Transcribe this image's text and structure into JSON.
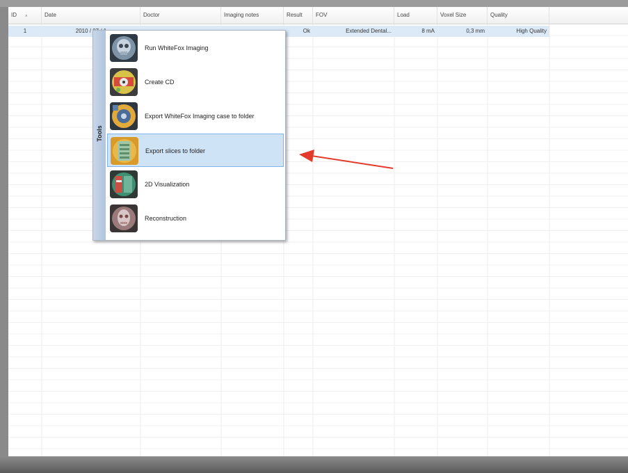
{
  "grid": {
    "columns": [
      "ID",
      "Date",
      "Doctor",
      "Imaging notes",
      "Result",
      "FOV",
      "Load",
      "Voxel Size",
      "Quality"
    ],
    "rows": [
      {
        "id": "1",
        "date": "2010 / 07 / 1",
        "doctor": "",
        "imaging_notes": "",
        "result": "Ok",
        "fov": "Extended Dental...",
        "load": "8 mA",
        "voxel_size": "0,3 mm",
        "quality": "High Quality"
      }
    ]
  },
  "context_menu": {
    "title": "Tools",
    "items": [
      {
        "label": "Run WhiteFox Imaging",
        "icon": "skull-xray-icon"
      },
      {
        "label": "Create CD",
        "icon": "cd-icon"
      },
      {
        "label": "Export WhiteFox Imaging case to folder",
        "icon": "folder-export-icon"
      },
      {
        "label": "Export slices to folder",
        "icon": "slices-export-icon",
        "highlighted": true
      },
      {
        "label": "2D Visualization",
        "icon": "visualization-2d-icon"
      },
      {
        "label": "Reconstruction",
        "icon": "reconstruction-icon"
      }
    ]
  },
  "colors": {
    "selected_row": "#dceaf8",
    "menu_highlight": "#cfe3f7",
    "arrow": "#e33a2c"
  }
}
